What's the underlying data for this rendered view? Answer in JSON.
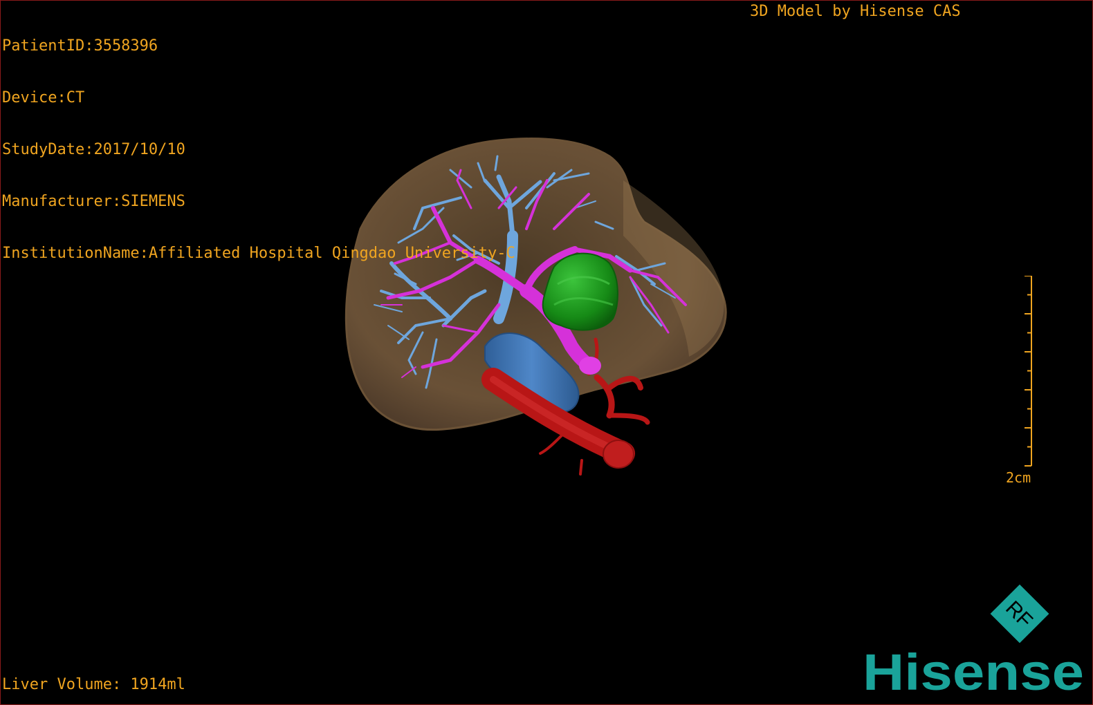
{
  "overlay": {
    "patient_id": "PatientID:3558396",
    "device": "Device:CT",
    "study_date": "StudyDate:2017/10/10",
    "manufacturer": "Manufacturer:SIEMENS",
    "institution": "InstitutionName:Affiliated Hospital Qingdao University-C",
    "model_credit": "3D Model by Hisense CAS",
    "liver_volume": "Liver Volume: 1914ml",
    "scale_label": "2cm"
  },
  "brand": {
    "name": "Hisense",
    "badge": "RF"
  },
  "colors": {
    "overlay_text": "#f0a520",
    "liver": "#8a6a45",
    "portal_vein": "#d531d9",
    "hepatic_vein": "#6ea6dd",
    "inferior_vena_cava": "#3e74b6",
    "tumor": "#1f9a1f",
    "artery": "#b81616",
    "brand": "#1aa39a",
    "border": "#8a1a1a"
  }
}
